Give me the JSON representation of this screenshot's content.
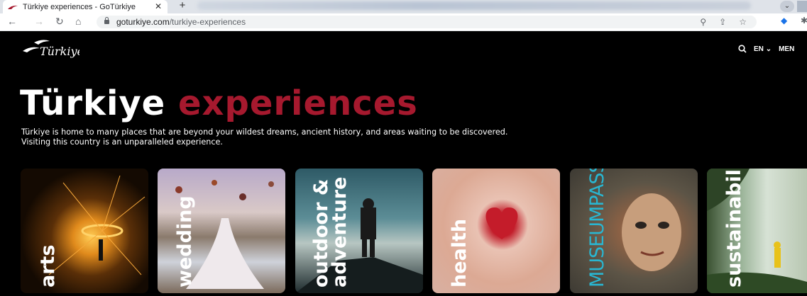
{
  "browser": {
    "tab_title": "Türkiye experiences - GoTürkiye",
    "tab_close": "✕",
    "new_tab": "+",
    "url_domain": "goturkiye.com",
    "url_path": "/turkiye-experiences",
    "nav": {
      "back": "←",
      "forward": "→",
      "reload": "↻",
      "home": "⌂"
    },
    "minimize": "⌄"
  },
  "site": {
    "logo_alt": "Türkiye",
    "search_icon": "search-icon",
    "language": "EN",
    "menu": "MEN",
    "headline_white": "Türkiye ",
    "headline_red": "experiences",
    "description": "Türkiye is home to many places that are beyond your wildest dreams, ancient history, and areas waiting to be discovered. Visiting this country is an unparalleled experience."
  },
  "cards": [
    {
      "label": "arts"
    },
    {
      "label": "wedding"
    },
    {
      "label_line1": "outdoor &",
      "label_line2": "adventure"
    },
    {
      "label": "health"
    },
    {
      "label": "MUSEUMPASS"
    },
    {
      "label": "sustainability"
    }
  ],
  "colors": {
    "accent": "#a6192e",
    "background": "#000000",
    "museum": "#29b6d1"
  }
}
